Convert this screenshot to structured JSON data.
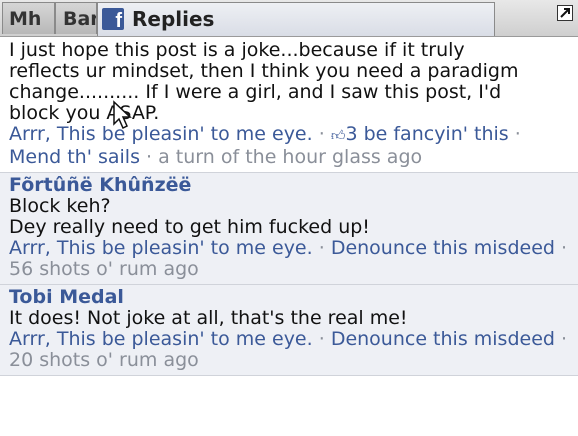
{
  "titlebar": {
    "tab_a": "Mh",
    "tab_b": "Bar",
    "active_title": "Replies",
    "fb_icon_glyph": "f"
  },
  "replies": [
    {
      "author": "",
      "lines": [
        "I just hope this post is a joke...because if it truly",
        "reflects ur mindset, then I think you need a paradigm",
        "change.......... If I were a girl, and I saw this post, I'd",
        "block you ASAP."
      ],
      "like_label": "Arrr, This be pleasin' to me eye.",
      "likes_count_label": "3 be fancyin' this",
      "extra_action": "Mend th' sails",
      "timestamp": "a turn of the hour glass ago"
    },
    {
      "author": "Fõrtûñë Khûñzëë",
      "lines": [
        "Block keh?",
        "Dey really need to get him fucked up!"
      ],
      "like_label": "Arrr, This be pleasin' to me eye.",
      "report_label": "Denounce this misdeed",
      "timestamp": "56 shots o' rum ago"
    },
    {
      "author": "Tobi Medal",
      "lines": [
        "It does! Not joke at all, that's the real me!"
      ],
      "like_label": "Arrr, This be pleasin' to me eye.",
      "report_label": "Denounce this misdeed",
      "timestamp": "20 shots o' rum ago"
    }
  ],
  "separator": "·",
  "colors": {
    "link": "#3b5998",
    "muted": "#8a8f99",
    "alt_row": "#eef0f5",
    "facebook_blue": "#3b5998"
  }
}
